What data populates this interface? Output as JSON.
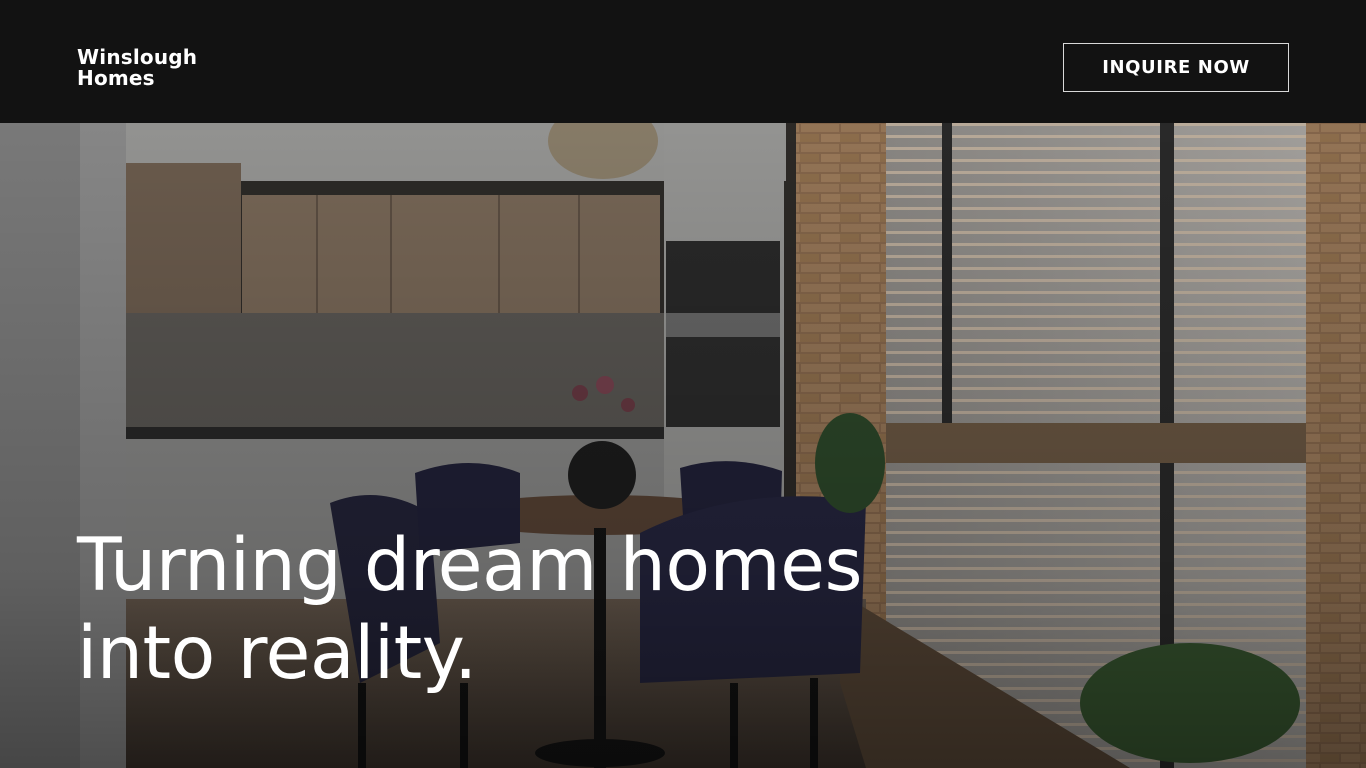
{
  "header": {
    "brand_line1": "Winslough",
    "brand_line2": "Homes",
    "cta_label": "INQUIRE NOW"
  },
  "hero": {
    "headline_line1": "Turning dream homes",
    "headline_line2": "into reality."
  },
  "colors": {
    "background": "#121212",
    "text": "#ffffff",
    "button_border": "#d9d9d9"
  }
}
